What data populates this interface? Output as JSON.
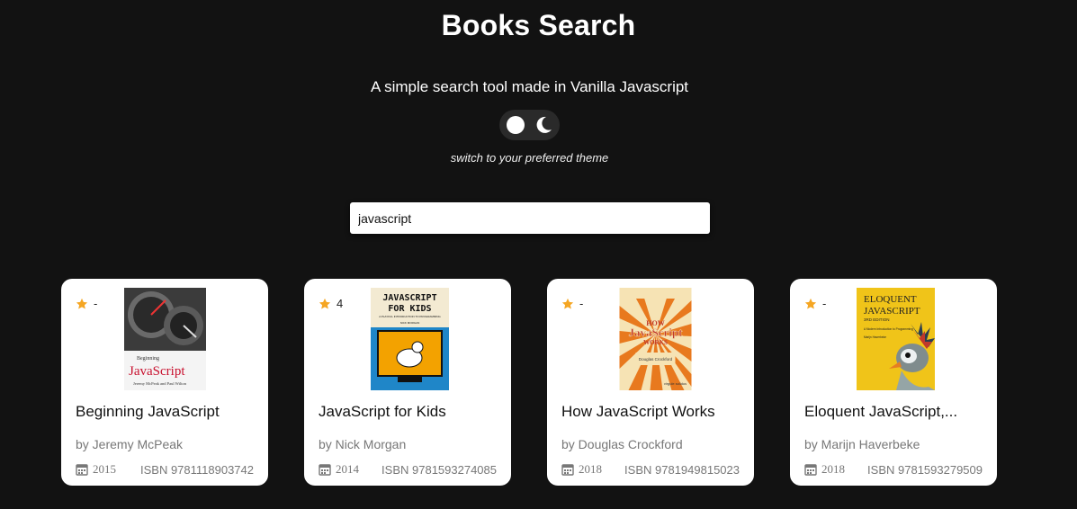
{
  "header": {
    "title": "Books Search",
    "subtitle": "A simple search tool made in Vanilla Javascript",
    "theme_hint": "switch to your preferred theme"
  },
  "theme_toggle": {
    "icons": [
      "sun-icon",
      "moon-icon"
    ]
  },
  "search": {
    "value": "javascript"
  },
  "books": [
    {
      "rating": "-",
      "title": "Beginning JavaScript",
      "author": "by Jeremy McPeak",
      "year": "2015",
      "isbn": "ISBN  9781118903742",
      "cover_text": [
        "Beginning",
        "JavaScript",
        "Jeremy McPeak and Paul Wilton"
      ]
    },
    {
      "rating": "4",
      "title": "JavaScript for Kids",
      "author": "by Nick Morgan",
      "year": "2014",
      "isbn": "ISBN  9781593274085",
      "cover_text": [
        "JAVASCRIPT",
        "FOR KIDS",
        "A PLAYFUL INTRODUCTION TO PROGRAMMING",
        "NICK MORGAN"
      ]
    },
    {
      "rating": "-",
      "title": "How JavaScript Works",
      "author": "by Douglas Crockford",
      "year": "2018",
      "isbn": "ISBN  9781949815023",
      "cover_text": [
        "HOW",
        "JavaScript",
        "WORKS",
        "Douglas Crockford",
        "virgule solidus"
      ]
    },
    {
      "rating": "-",
      "title": "Eloquent JavaScript,...",
      "author": "by Marijn Haverbeke",
      "year": "2018",
      "isbn": "ISBN  9781593279509",
      "cover_text": [
        "ELOQUENT",
        "JAVASCRIPT",
        "3RD EDITION",
        "A Modern Introduction to Programming",
        "Marijn Haverbeke"
      ]
    }
  ],
  "colors": {
    "background": "#121212",
    "card": "#ffffff",
    "star": "#f5a623",
    "muted_text": "#777777"
  }
}
